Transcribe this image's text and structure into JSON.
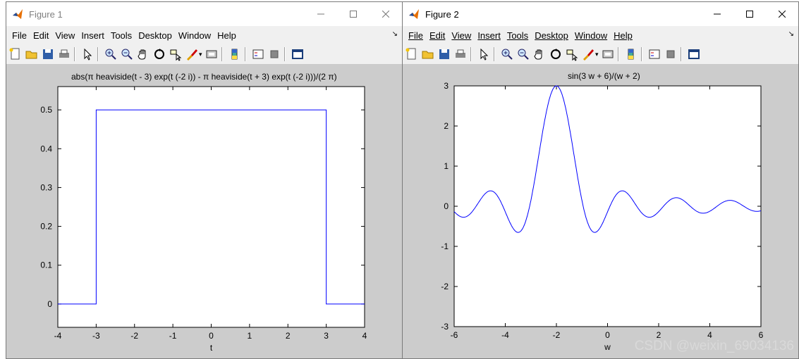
{
  "figure1": {
    "title": "Figure 1",
    "menu": [
      "File",
      "Edit",
      "View",
      "Insert",
      "Tools",
      "Desktop",
      "Window",
      "Help"
    ],
    "plot_title": "abs(π heaviside(t - 3) exp(t (-2 i)) - π heaviside(t + 3) exp(t (-2 i)))/(2 π)",
    "xlabel": "t"
  },
  "figure2": {
    "title": "Figure 2",
    "menu": [
      "File",
      "Edit",
      "View",
      "Insert",
      "Tools",
      "Desktop",
      "Window",
      "Help"
    ],
    "plot_title": "sin(3 w + 6)/(w + 2)",
    "xlabel": "w"
  },
  "watermark": "CSDN @weixin_69034136",
  "toolbar_icons": [
    "new-file-icon",
    "open-icon",
    "save-icon",
    "print-icon",
    "pointer-icon",
    "zoom-in-icon",
    "zoom-out-icon",
    "pan-icon",
    "rotate-icon",
    "data-cursor-icon",
    "brush-icon",
    "link-icon",
    "colorbar-icon",
    "legend-icon",
    "hide-plot-tools-icon",
    "show-plot-tools-icon"
  ],
  "colors": {
    "line": "#0000ff",
    "window_bg": "#cccccc"
  },
  "chart_data": [
    {
      "type": "line",
      "title": "abs(π heaviside(t - 3) exp(t (-2 i)) - π heaviside(t + 3) exp(t (-2 i)))/(2 π)",
      "xlabel": "t",
      "ylabel": "",
      "xlim": [
        -4,
        4
      ],
      "ylim": [
        -0.06,
        0.56
      ],
      "xticks": [
        -4,
        -3,
        -2,
        -1,
        0,
        1,
        2,
        3,
        4
      ],
      "yticks": [
        0,
        0.1,
        0.2,
        0.3,
        0.4,
        0.5
      ],
      "x": [
        -4,
        -3,
        -3,
        -3,
        -3,
        3,
        3,
        3,
        3,
        4
      ],
      "y": [
        0,
        0,
        0.25,
        0.25,
        0.5,
        0.5,
        0.25,
        0.25,
        0,
        0
      ],
      "grid": false
    },
    {
      "type": "line",
      "title": "sin(3 w + 6)/(w + 2)",
      "xlabel": "w",
      "ylabel": "",
      "xlim": [
        -6,
        6
      ],
      "ylim": [
        -3,
        3
      ],
      "xticks": [
        -6,
        -4,
        -2,
        0,
        2,
        4,
        6
      ],
      "yticks": [
        -3,
        -2,
        -1,
        0,
        1,
        2,
        3
      ],
      "function": "sin(3 w + 6)/(w + 2)",
      "grid": false
    }
  ]
}
